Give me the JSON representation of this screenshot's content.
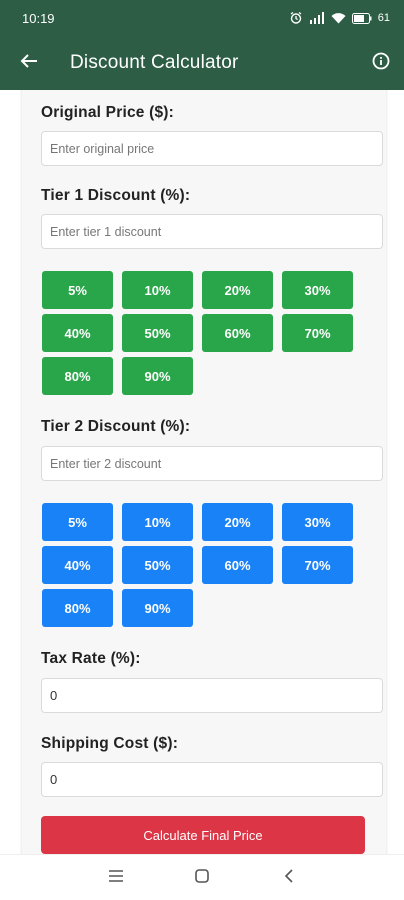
{
  "status_bar": {
    "time": "10:19",
    "battery": "61"
  },
  "app_bar": {
    "title": "Discount Calculator",
    "back_icon": "arrow-left-icon",
    "info_icon": "info-circle-icon"
  },
  "form": {
    "original_price": {
      "label": "Original Price ($):",
      "placeholder": "Enter original price",
      "value": ""
    },
    "tier1": {
      "label": "Tier 1 Discount (%):",
      "placeholder": "Enter tier 1 discount",
      "value": "",
      "presets": [
        "5%",
        "10%",
        "20%",
        "30%",
        "40%",
        "50%",
        "60%",
        "70%",
        "80%",
        "90%"
      ]
    },
    "tier2": {
      "label": "Tier 2 Discount (%):",
      "placeholder": "Enter tier 2 discount",
      "value": "",
      "presets": [
        "5%",
        "10%",
        "20%",
        "30%",
        "40%",
        "50%",
        "60%",
        "70%",
        "80%",
        "90%"
      ]
    },
    "tax_rate": {
      "label": "Tax Rate (%):",
      "value": "0"
    },
    "shipping": {
      "label": "Shipping Cost ($):",
      "value": "0"
    },
    "calculate_label": "Calculate Final Price"
  },
  "colors": {
    "app_bar": "#2d5e45",
    "tier1_button": "#2aa64a",
    "tier2_button": "#1a82f7",
    "calculate_button": "#dc3545"
  },
  "nav_bar": {
    "menu_icon": "menu-icon",
    "home_icon": "home-square-icon",
    "back_icon": "back-chevron-icon"
  }
}
